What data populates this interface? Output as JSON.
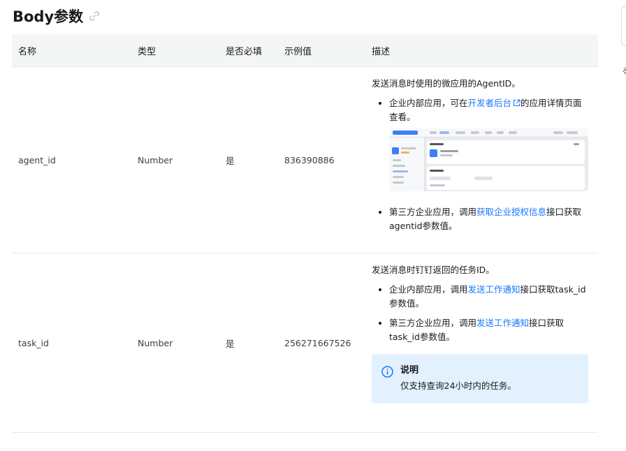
{
  "section": {
    "title": "Body参数"
  },
  "table": {
    "headers": [
      "名称",
      "类型",
      "是否必填",
      "示例值",
      "描述"
    ],
    "rows": [
      {
        "name": "agent_id",
        "type": "Number",
        "required": "是",
        "example": "836390886",
        "desc": {
          "intro": "发送消息时使用的微应用的AgentID。",
          "b1_pre": "企业内部应用，可在",
          "b1_link": "开发者后台",
          "b1_post": "的应用详情页面查看。",
          "b2_pre": "第三方企业应用，调用",
          "b2_link": "获取企业授权信息",
          "b2_post": "接口获取agentid参数值。"
        }
      },
      {
        "name": "task_id",
        "type": "Number",
        "required": "是",
        "example": "256271667526",
        "desc": {
          "intro": "发送消息时钉钉返回的任务ID。",
          "b1_pre": "企业内部应用，调用",
          "b1_link": "发送工作通知",
          "b1_post": "接口获取task_id参数值。",
          "b2_pre": "第三方企业应用，调用",
          "b2_link": "发送工作通知",
          "b2_post": "接口获取task_id参数值。",
          "note_title": "说明",
          "note_body": "仅支持查询24小时内的任务。"
        }
      }
    ]
  },
  "edge_text": "る",
  "colors": {
    "link": "#1677ff",
    "header_bg": "#f4f5f5",
    "note_bg": "#e3f0fd",
    "info": "#1677ff"
  }
}
